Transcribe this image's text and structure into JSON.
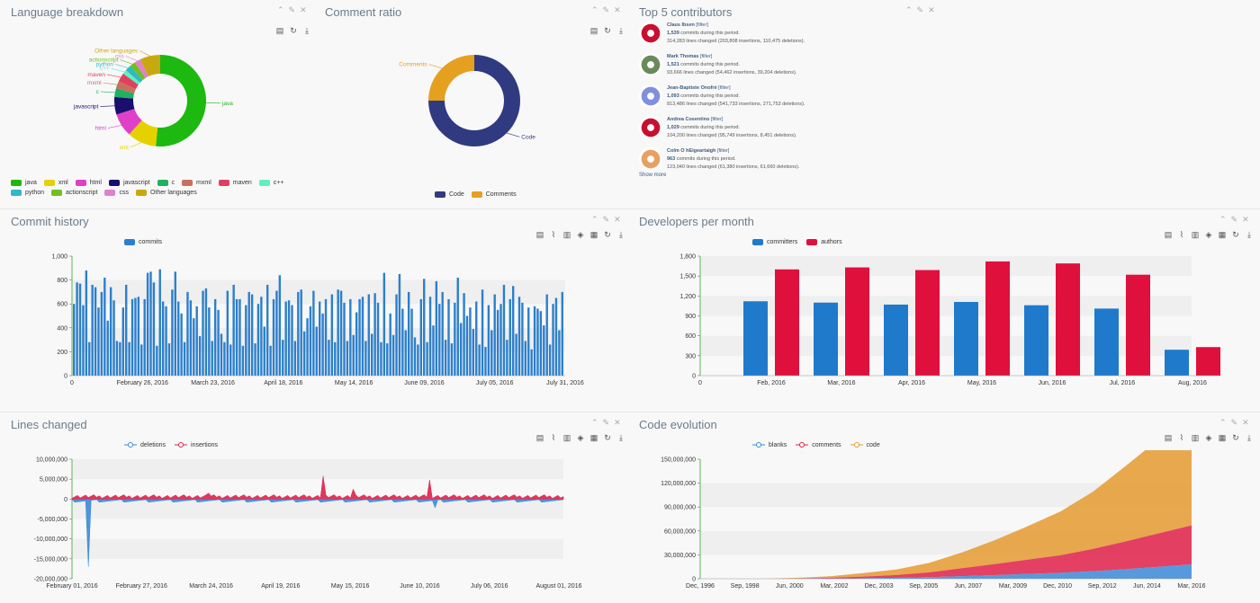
{
  "panels": {
    "language": {
      "title": "Language breakdown"
    },
    "comment": {
      "title": "Comment ratio"
    },
    "contributors": {
      "title": "Top 5 contributors"
    },
    "commits": {
      "title": "Commit history"
    },
    "developers": {
      "title": "Developers per month"
    },
    "lines": {
      "title": "Lines changed"
    },
    "evolution": {
      "title": "Code evolution"
    }
  },
  "panel_controls": {
    "collapse": "⌃",
    "settings": "🔧",
    "close": "✕"
  },
  "language_legend": [
    {
      "name": "java",
      "color": "#1db810"
    },
    {
      "name": "xml",
      "color": "#e5d100"
    },
    {
      "name": "html",
      "color": "#e040c8"
    },
    {
      "name": "javascript",
      "color": "#1a0f6e"
    },
    {
      "name": "c",
      "color": "#1fb060"
    },
    {
      "name": "mxml",
      "color": "#c87060"
    },
    {
      "name": "maven",
      "color": "#e0405e"
    },
    {
      "name": "c++",
      "color": "#60f0c0"
    },
    {
      "name": "python",
      "color": "#30b8c8"
    },
    {
      "name": "actionscript",
      "color": "#70c020"
    },
    {
      "name": "css",
      "color": "#e080d0"
    },
    {
      "name": "Other languages",
      "color": "#c8a810"
    }
  ],
  "comment_legend": [
    {
      "name": "Code",
      "color": "#303a80"
    },
    {
      "name": "Comments",
      "color": "#e5a020"
    }
  ],
  "contributors": [
    {
      "name": "Claus Ibsen",
      "filter": "[filter]",
      "commits": "1,539",
      "commits_text": "commits during this period.",
      "lines": "314,283 lines changed (203,808 insertions, 110,475 deletions).",
      "avatar_color": "#c8102e"
    },
    {
      "name": "Mark Thomas",
      "filter": "[filter]",
      "commits": "1,521",
      "commits_text": "commits during this period.",
      "lines": "93,666 lines changed (54,462 insertions, 39,204 deletions).",
      "avatar_color": "#6a8a5a"
    },
    {
      "name": "Jean-Baptiste Onofré",
      "filter": "[filter]",
      "commits": "1,093",
      "commits_text": "commits during this period.",
      "lines": "813,486 lines changed (541,733 insertions, 271,753 deletions).",
      "avatar_color": "#8090e0"
    },
    {
      "name": "Andrea Cosentino",
      "filter": "[filter]",
      "commits": "1,029",
      "commits_text": "commits during this period.",
      "lines": "104,200 lines changed (95,749 insertions, 8,451 deletions).",
      "avatar_color": "#c8102e"
    },
    {
      "name": "Colm O hEigeartaigh",
      "filter": "[filter]",
      "commits": "963",
      "commits_text": "commits during this period.",
      "lines": "123,040 lines changed (61,380 insertions, 61,660 deletions).",
      "avatar_color": "#e8a060"
    }
  ],
  "show_more": "Show more",
  "chart_data": [
    {
      "id": "language",
      "type": "pie",
      "donut": true,
      "labels": [
        "java",
        "xml",
        "html",
        "javascript",
        "c",
        "mxml",
        "maven",
        "c++",
        "python",
        "actionscript",
        "css",
        "Other languages"
      ],
      "values": [
        50,
        10,
        8,
        6,
        3,
        2.5,
        3,
        1.5,
        2,
        2,
        2,
        7
      ],
      "colors": [
        "#1db810",
        "#e5d100",
        "#e040c8",
        "#1a0f6e",
        "#1fb060",
        "#c87060",
        "#e0405e",
        "#60f0c0",
        "#30b8c8",
        "#70c020",
        "#e080d0",
        "#c8a810"
      ]
    },
    {
      "id": "comment",
      "type": "pie",
      "donut": true,
      "labels": [
        "Code",
        "Comments"
      ],
      "values": [
        75,
        25
      ],
      "colors": [
        "#303a80",
        "#e5a020"
      ]
    },
    {
      "id": "commits",
      "type": "bar",
      "series": [
        {
          "name": "commits",
          "color": "#2c7fcc"
        }
      ],
      "yticks": [
        "0",
        "200",
        "400",
        "600",
        "800",
        "1,000"
      ],
      "ylim": [
        0,
        1000
      ],
      "xticks": [
        "0",
        "February 26, 2016",
        "March 23, 2016",
        "April 18, 2016",
        "May 14, 2016",
        "June 09, 2016",
        "July 05, 2016",
        "July 31, 2016"
      ],
      "values": [
        600,
        780,
        770,
        590,
        880,
        280,
        760,
        740,
        570,
        700,
        820,
        460,
        740,
        630,
        290,
        280,
        570,
        760,
        280,
        640,
        650,
        660,
        260,
        640,
        860,
        870,
        780,
        250,
        890,
        620,
        580,
        270,
        720,
        870,
        620,
        520,
        280,
        700,
        630,
        480,
        580,
        330,
        710,
        730,
        570,
        290,
        640,
        550,
        350,
        280,
        710,
        260,
        760,
        640,
        640,
        250,
        590,
        700,
        680,
        270,
        600,
        660,
        410,
        760,
        250,
        640,
        710,
        840,
        300,
        620,
        630,
        590,
        290,
        700,
        720,
        370,
        480,
        580,
        710,
        410,
        620,
        520,
        640,
        300,
        680,
        280,
        720,
        710,
        610,
        290,
        640,
        340,
        530,
        640,
        660,
        290,
        680,
        350,
        690,
        610,
        280,
        860,
        270,
        520,
        340,
        680,
        850,
        560,
        380,
        700,
        560,
        320,
        260,
        640,
        810,
        280,
        660,
        420,
        790,
        600,
        700,
        300,
        640,
        270,
        610,
        820,
        440,
        690,
        500,
        570,
        390,
        620,
        260,
        720,
        240,
        590,
        380,
        680,
        550,
        600,
        760,
        300,
        640,
        750,
        350,
        660,
        610,
        290,
        570,
        220,
        580,
        560,
        540,
        420,
        680,
        260,
        600,
        650,
        380,
        700
      ],
      "bar_labels": false
    },
    {
      "id": "developers",
      "type": "bar",
      "series": [
        {
          "name": "committers",
          "color": "#1f7acc",
          "values": [
            1120,
            1100,
            1070,
            1110,
            1060,
            1010,
            390
          ]
        },
        {
          "name": "authors",
          "color": "#e0103c",
          "values": [
            1600,
            1630,
            1590,
            1720,
            1690,
            1520,
            430
          ]
        }
      ],
      "categories": [
        "Feb, 2016",
        "Mar, 2016",
        "Apr, 2016",
        "May, 2016",
        "Jun, 2016",
        "Jul, 2016",
        "Aug, 2016"
      ],
      "yticks": [
        "0",
        "300",
        "600",
        "900",
        "1,200",
        "1,500",
        "1,800"
      ],
      "ylim": [
        0,
        1800
      ]
    },
    {
      "id": "lines",
      "type": "area",
      "series": [
        {
          "name": "deletions",
          "color": "#3a8ad8"
        },
        {
          "name": "insertions",
          "color": "#e0204a"
        }
      ],
      "yticks": [
        "-20,000,000",
        "-15,000,000",
        "-10,000,000",
        "-5,000,000",
        "0",
        "5,000,000",
        "10,000,000"
      ],
      "ylim": [
        -20000000,
        10000000
      ],
      "xticks": [
        "February 01, 2016",
        "February 27, 2016",
        "March 24, 2016",
        "April 19, 2016",
        "May 15, 2016",
        "June 10, 2016",
        "July 06, 2016",
        "August 01, 2016"
      ]
    },
    {
      "id": "evolution",
      "type": "area",
      "stacked": true,
      "series": [
        {
          "name": "blanks",
          "color": "#3a8ad8"
        },
        {
          "name": "comments",
          "color": "#e0204a"
        },
        {
          "name": "code",
          "color": "#e59a30"
        }
      ],
      "yticks": [
        "0",
        "30,000,000",
        "60,000,000",
        "90,000,000",
        "120,000,000",
        "150,000,000"
      ],
      "ylim": [
        0,
        150000000
      ],
      "xticks": [
        "Dec, 1996",
        "Sep, 1998",
        "Jun, 2000",
        "Mar, 2002",
        "Dec, 2003",
        "Sep, 2005",
        "Jun, 2007",
        "Mar, 2009",
        "Dec, 2010",
        "Sep, 2012",
        "Jun, 2014",
        "Mar, 2016"
      ],
      "code_totals": [
        0,
        0,
        0,
        800000,
        2000000,
        4500000,
        7000000,
        12000000,
        20000000,
        30000000,
        42000000,
        55000000,
        72000000,
        95000000,
        118000000,
        143000000
      ],
      "comments_totals": [
        0,
        0,
        0,
        300000,
        900000,
        2000000,
        3500000,
        6000000,
        10000000,
        14000000,
        18000000,
        22000000,
        28000000,
        35000000,
        42000000,
        49000000
      ],
      "blanks_totals": [
        0,
        0,
        0,
        100000,
        300000,
        700000,
        1200000,
        2000000,
        3200000,
        4500000,
        6000000,
        7500000,
        9500000,
        12000000,
        15000000,
        18000000
      ]
    }
  ]
}
